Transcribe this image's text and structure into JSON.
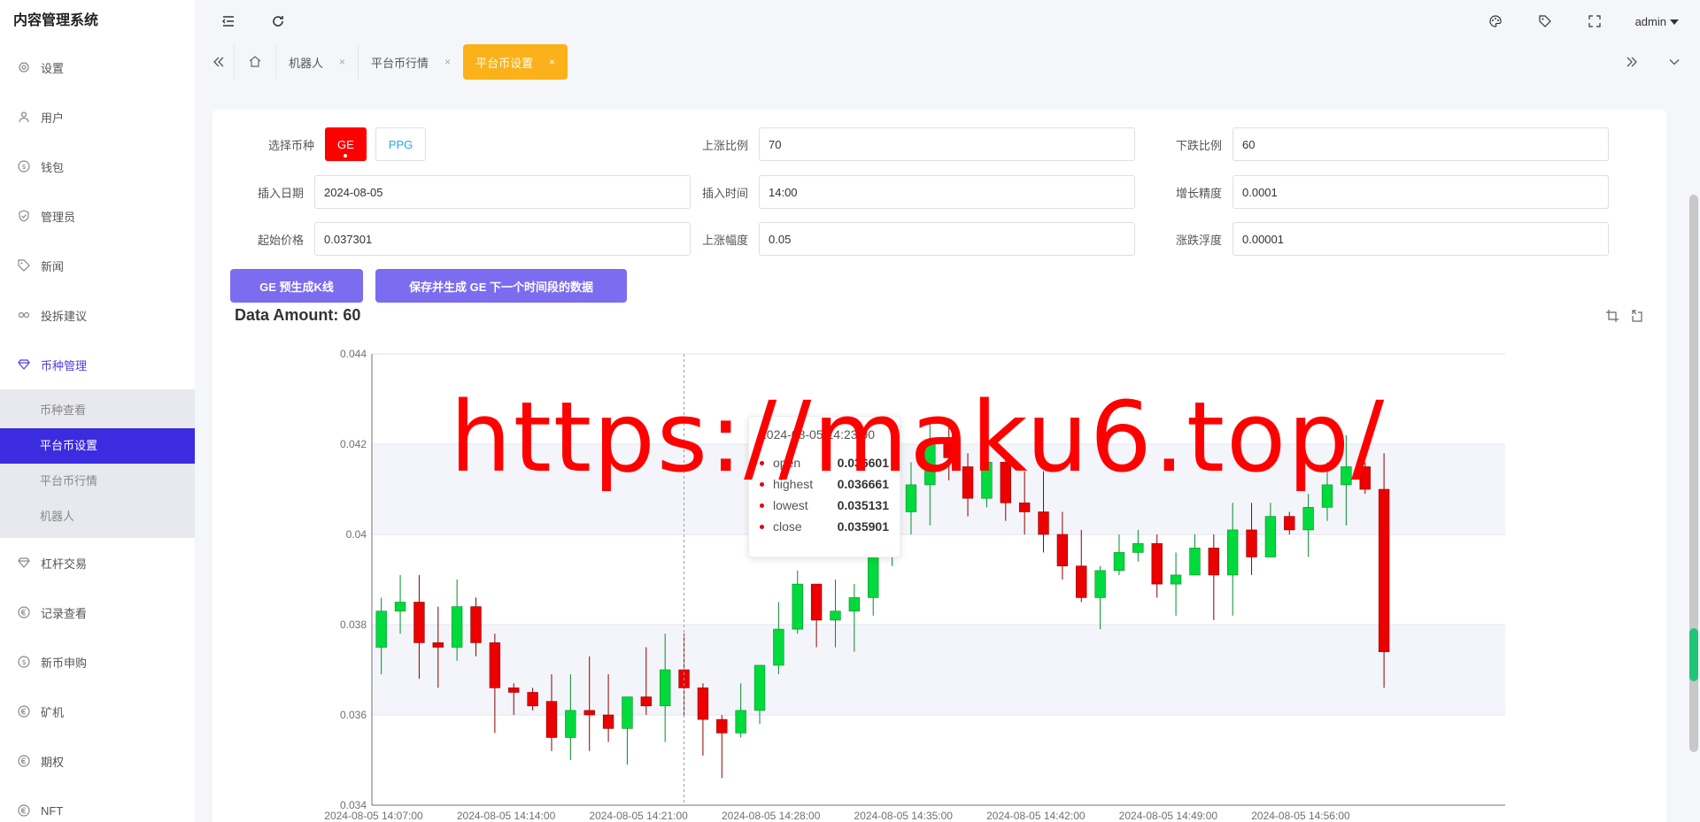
{
  "app": {
    "title": "内容管理系统",
    "user": "admin"
  },
  "sidebar": {
    "items": [
      {
        "label": "设置",
        "icon": "gear-icon"
      },
      {
        "label": "用户",
        "icon": "user-icon"
      },
      {
        "label": "钱包",
        "icon": "dollar-circle-icon"
      },
      {
        "label": "管理员",
        "icon": "shield-check-icon"
      },
      {
        "label": "新闻",
        "icon": "tag-icon"
      },
      {
        "label": "投拆建议",
        "icon": "link-icon"
      },
      {
        "label": "币种管理",
        "icon": "diamond-icon"
      }
    ],
    "sub_items": [
      {
        "label": "币种查看"
      },
      {
        "label": "平台币设置"
      },
      {
        "label": "平台币行情"
      },
      {
        "label": "机器人"
      }
    ],
    "items2": [
      {
        "label": "杠杆交易",
        "icon": "diamond-icon"
      },
      {
        "label": "记录查看",
        "icon": "euro-circle-icon"
      },
      {
        "label": "新币申购",
        "icon": "dollar-circle-icon"
      },
      {
        "label": "矿机",
        "icon": "euro-circle-icon"
      },
      {
        "label": "期权",
        "icon": "euro-circle-icon"
      },
      {
        "label": "NFT",
        "icon": "euro-circle-icon"
      }
    ]
  },
  "tabs": [
    {
      "label": "机器人"
    },
    {
      "label": "平台币行情"
    },
    {
      "label": "平台币设置"
    }
  ],
  "tab_close": "×",
  "form": {
    "coin_label": "选择币种",
    "coins": [
      "GE",
      "PPG"
    ],
    "rise_ratio_label": "上涨比例",
    "rise_ratio": "70",
    "fall_ratio_label": "下跌比例",
    "fall_ratio": "60",
    "insert_date_label": "插入日期",
    "insert_date": "2024-08-05",
    "insert_time_label": "插入时间",
    "insert_time": "14:00",
    "precision_label": "增长精度",
    "precision": "0.0001",
    "start_price_label": "起始价格",
    "start_price": "0.037301",
    "rise_range_label": "上涨幅度",
    "rise_range": "0.05",
    "fluct_label": "涨跌浮度",
    "fluct": "0.00001"
  },
  "buttons": {
    "pregen": "GE 预生成K线",
    "save_next": "保存并生成 GE 下一个时间段的数据"
  },
  "data_amount": "Data Amount: 60",
  "tooltip": {
    "title": "2024-08-05 14:23:00",
    "rows": [
      {
        "name": "open",
        "value": "0.036601"
      },
      {
        "name": "highest",
        "value": "0.036661"
      },
      {
        "name": "lowest",
        "value": "0.035131"
      },
      {
        "name": "close",
        "value": "0.035901"
      }
    ]
  },
  "watermark": "https://maku6.top/",
  "colors": {
    "up": "#00da3c",
    "down": "#ec0000",
    "accent": "#3b2ce0",
    "tab_active": "#fbb11a"
  },
  "chart_data": {
    "type": "candlestick",
    "ylim": [
      0.034,
      0.044
    ],
    "y_ticks": [
      "0.034",
      "0.036",
      "0.038",
      "0.04",
      "0.042",
      "0.044"
    ],
    "x_tick_labels": [
      "2024-08-05 14:07:00",
      "2024-08-05 14:14:00",
      "2024-08-05 14:21:00",
      "2024-08-05 14:28:00",
      "2024-08-05 14:35:00",
      "2024-08-05 14:42:00",
      "2024-08-05 14:49:00",
      "2024-08-05 14:56:00"
    ],
    "x_tick_indices": [
      0,
      7,
      14,
      21,
      28,
      35,
      42,
      49
    ],
    "start_time": "14:07",
    "candles": [
      [
        0.0375,
        0.0383,
        0.0369,
        0.0386
      ],
      [
        0.0383,
        0.0385,
        0.0378,
        0.0391
      ],
      [
        0.0385,
        0.0376,
        0.0368,
        0.0391
      ],
      [
        0.0376,
        0.0375,
        0.0366,
        0.0384
      ],
      [
        0.0375,
        0.0384,
        0.0372,
        0.039
      ],
      [
        0.0384,
        0.0376,
        0.0373,
        0.0386
      ],
      [
        0.0376,
        0.0366,
        0.0356,
        0.0378
      ],
      [
        0.0366,
        0.0365,
        0.036,
        0.0367
      ],
      [
        0.0365,
        0.0362,
        0.0361,
        0.0366
      ],
      [
        0.0363,
        0.0355,
        0.0352,
        0.0369
      ],
      [
        0.0355,
        0.0361,
        0.035,
        0.0369
      ],
      [
        0.0361,
        0.036,
        0.0352,
        0.0373
      ],
      [
        0.036,
        0.0357,
        0.0354,
        0.0369
      ],
      [
        0.0357,
        0.0364,
        0.0349,
        0.0364
      ],
      [
        0.0364,
        0.0362,
        0.036,
        0.0375
      ],
      [
        0.0362,
        0.037,
        0.0354,
        0.0378
      ],
      [
        0.037,
        0.0366,
        0.036,
        0.0378
      ],
      [
        0.0366,
        0.0359,
        0.0351,
        0.0367
      ],
      [
        0.0359,
        0.0356,
        0.0346,
        0.036
      ],
      [
        0.0356,
        0.0361,
        0.0355,
        0.0367
      ],
      [
        0.0361,
        0.0371,
        0.0358,
        0.0371
      ],
      [
        0.0371,
        0.0379,
        0.0369,
        0.0385
      ],
      [
        0.0379,
        0.0389,
        0.0378,
        0.0392
      ],
      [
        0.0389,
        0.0381,
        0.0375,
        0.0389
      ],
      [
        0.0381,
        0.0383,
        0.0375,
        0.039
      ],
      [
        0.0383,
        0.0386,
        0.0374,
        0.0389
      ],
      [
        0.0386,
        0.0395,
        0.0382,
        0.0398
      ],
      [
        0.0395,
        0.0405,
        0.0393,
        0.041
      ],
      [
        0.0405,
        0.0411,
        0.04,
        0.0416
      ],
      [
        0.0411,
        0.0421,
        0.0402,
        0.0425
      ],
      [
        0.0421,
        0.0417,
        0.0412,
        0.0425
      ],
      [
        0.0415,
        0.0408,
        0.0404,
        0.0418
      ],
      [
        0.0408,
        0.0416,
        0.0406,
        0.042
      ],
      [
        0.0416,
        0.0407,
        0.0403,
        0.0418
      ],
      [
        0.0407,
        0.0405,
        0.04,
        0.0414
      ],
      [
        0.0405,
        0.04,
        0.0396,
        0.0414
      ],
      [
        0.04,
        0.0393,
        0.039,
        0.0405
      ],
      [
        0.0393,
        0.0386,
        0.0385,
        0.0401
      ],
      [
        0.0386,
        0.0392,
        0.0379,
        0.0393
      ],
      [
        0.0392,
        0.0396,
        0.0391,
        0.04
      ],
      [
        0.0396,
        0.0398,
        0.0394,
        0.0401
      ],
      [
        0.0398,
        0.0389,
        0.0386,
        0.04
      ],
      [
        0.0389,
        0.0391,
        0.0382,
        0.0396
      ],
      [
        0.0391,
        0.0397,
        0.0391,
        0.04
      ],
      [
        0.0397,
        0.0391,
        0.0381,
        0.04
      ],
      [
        0.0391,
        0.0401,
        0.0382,
        0.0407
      ],
      [
        0.0401,
        0.0395,
        0.0391,
        0.0407
      ],
      [
        0.0395,
        0.0404,
        0.0395,
        0.0407
      ],
      [
        0.0404,
        0.0401,
        0.04,
        0.0405
      ],
      [
        0.0401,
        0.0406,
        0.0395,
        0.0409
      ],
      [
        0.0406,
        0.0411,
        0.0403,
        0.0416
      ],
      [
        0.0411,
        0.0415,
        0.0402,
        0.0422
      ],
      [
        0.0415,
        0.041,
        0.0409,
        0.0416
      ],
      [
        0.041,
        0.0374,
        0.0366,
        0.0418
      ]
    ]
  }
}
